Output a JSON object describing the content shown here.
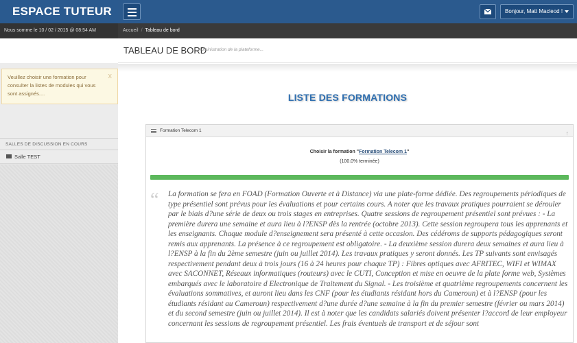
{
  "brand": "ESPACE TUTEUR",
  "header": {
    "user_greeting": "Bonjour, Matt Macleod !",
    "menu_icon": "hamburger-icon",
    "mail_icon": "envelope-icon"
  },
  "status": {
    "date_text": "Nous somme le 10 / 02 / 2015 @ 08:54 AM"
  },
  "breadcrumb": {
    "home": "Accueil",
    "current": "Tableau de bord"
  },
  "sidebar": {
    "alert_text": "Veuillez choisir une formation pour consulter la listes de modules qui vous sont assignés....",
    "alert_close": "x",
    "rooms_header": "SALLES DE DISCUSSION EN COURS",
    "rooms": [
      {
        "label": "Salle TEST",
        "icon": "video-camera-icon"
      }
    ]
  },
  "page": {
    "title": "TABLEAU DE BORD",
    "subtitle": "Administration de la plateforme...",
    "list_title": "LISTE DES FORMATIONS"
  },
  "panel": {
    "title": "Formation Telecom 1",
    "choose_prefix": "Choisir la formation \"",
    "choose_link": "Formation Telecom 1",
    "choose_suffix": "\"",
    "completion": "(100.0% terminée)",
    "progress": 1.0,
    "progress_color": "#5cb85c",
    "quote_mark": "“",
    "description": "La formation se fera en FOAD (Formation Ouverte et à Distance) via une plate-forme dédiée. Des regroupements périodiques de type présentiel sont prévus pour les évaluations et pour certains cours. A noter que les travaux pratiques pourraient se dérouler par le biais d?une série de deux ou trois stages en entreprises. Quatre sessions de regroupement présentiel sont prévues : - La première durera une semaine et aura lieu à l?ENSP dès la rentrée (octobre 2013). Cette session regroupera tous les apprenants et les enseignants. Chaque module d?enseignement sera présenté à cette occasion. Des cédéroms de supports pédagogiques seront remis aux apprenants. La présence à ce regroupement est obligatoire. - La deuxième session durera deux semaines et aura lieu à l?ENSP à la fin du 2ème semestre (juin ou juillet 2014). Les travaux pratiques y seront donnés. Les TP suivants sont envisagés respectivement pendant deux à trois jours (16 à 24 heures pour chaque TP) : Fibres optiques avec AFRITEC, WIFI et WIMAX avec SACONNET, Réseaux informatiques (routeurs) avec le CUTI, Conception et mise en oeuvre de la plate forme web, Systèmes embarqués avec le laboratoire d Electronique de Traitement du Signal. - Les troisième et quatrième regroupements concernent les évaluations sommatives, et auront lieu dans les CNF (pour les étudiants résidant hors du Cameroun) et à l?ENSP (pour les étudiants résidant au Cameroun) respectivement d?une durée d?une semaine à la fin du premier semestre (février ou mars 2014) et du second semestre (juin ou juillet 2014). Il est à noter que les candidats salariés doivent présenter l?accord de leur employeur concernant les sessions de regroupement présentiel. Les frais éventuels de transport et de séjour sont"
  }
}
